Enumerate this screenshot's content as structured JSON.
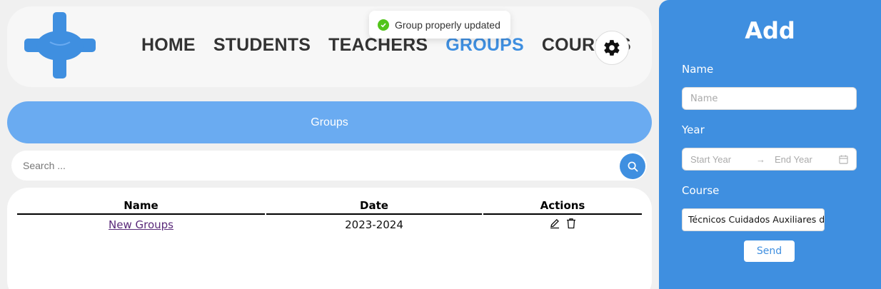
{
  "nav": {
    "items": [
      "HOME",
      "STUDENTS",
      "TEACHERS",
      "GROUPS",
      "COURSES"
    ],
    "active": "GROUPS"
  },
  "toast": {
    "message": "Group properly updated"
  },
  "banner": {
    "title": "Groups"
  },
  "search": {
    "placeholder": "Search ..."
  },
  "table": {
    "columns": [
      "Name",
      "Date",
      "Actions"
    ],
    "rows": [
      {
        "name": "New Groups",
        "date": "2023-2024"
      }
    ]
  },
  "side": {
    "title": "Add",
    "name_label": "Name",
    "name_placeholder": "Name",
    "year_label": "Year",
    "start_placeholder": "Start Year",
    "end_placeholder": "End Year",
    "course_label": "Course",
    "course_value": "Técnicos Cuidados Auxiliares de Enfermería",
    "send_label": "Send"
  },
  "colors": {
    "accent": "#3f8fe0",
    "banner": "#6aabf1",
    "success": "#52c41a"
  }
}
